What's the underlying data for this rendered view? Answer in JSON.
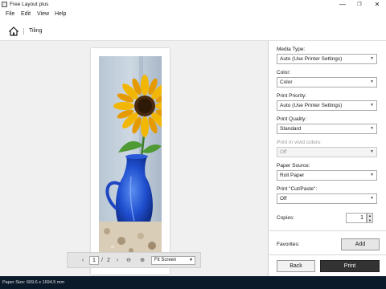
{
  "window": {
    "title": "Free Layout plus",
    "minimize": "—",
    "maximize": "❐",
    "close": "✕"
  },
  "menu": [
    "File",
    "Edit",
    "View",
    "Help"
  ],
  "toolbar": {
    "breadcrumb": "Tiling"
  },
  "preview": {
    "current_page": "1",
    "page_separator": "/",
    "total_pages": "2",
    "zoom_select": "Fit Screen",
    "prev_glyph": "‹",
    "next_glyph": "›",
    "zoom_out_glyph": "⊖",
    "zoom_in_glyph": "⊕"
  },
  "settings": {
    "media_type_label": "Media Type:",
    "media_type_value": "Auto (Use Printer Settings)",
    "color_label": "Color:",
    "color_value": "Color",
    "print_priority_label": "Print Priority:",
    "print_priority_value": "Auto (Use Printer Settings)",
    "print_quality_label": "Print Quality:",
    "print_quality_value": "Standard",
    "vivid_label": "Print in vivid colors:",
    "vivid_value": "Off",
    "paper_source_label": "Paper Source:",
    "paper_source_value": "Roll Paper",
    "cut_paste_label": "Print \"Cut/Paste\":",
    "cut_paste_value": "Off",
    "copies_label": "Copies:",
    "copies_value": "1",
    "favorites_label": "Favorites:",
    "add_label": "Add",
    "back_label": "Back",
    "print_label": "Print"
  },
  "status": {
    "paper_size": "Paper Size: 609.6 x 1694.5 mm"
  },
  "colors": {
    "accent_dark": "#333333",
    "statusbar": "#0b1a2a",
    "preview_bg": "#f0f0f0"
  }
}
